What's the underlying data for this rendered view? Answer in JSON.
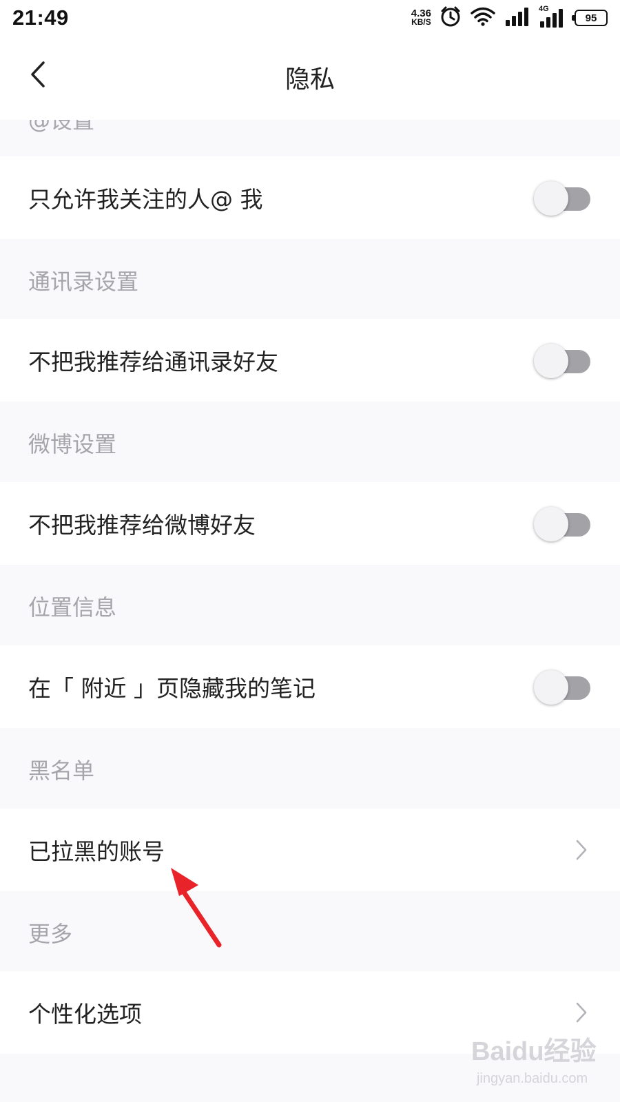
{
  "status_bar": {
    "time": "21:49",
    "net_speed_value": "4.36",
    "net_speed_unit": "KB/S",
    "signal_label": "4G",
    "battery": "95"
  },
  "header": {
    "title": "隐私"
  },
  "cut_section": {
    "label": "@设置"
  },
  "rows": {
    "at_only_followed": {
      "label": "只允许我关注的人@ 我",
      "enabled": false
    },
    "contacts_section": "通讯录设置",
    "no_recommend_contacts": {
      "label": "不把我推荐给通讯录好友",
      "enabled": false
    },
    "weibo_section": "微博设置",
    "no_recommend_weibo": {
      "label": "不把我推荐给微博好友",
      "enabled": false
    },
    "location_section": "位置信息",
    "hide_nearby": {
      "label": "在「 附近 」页隐藏我的笔记",
      "enabled": false
    },
    "blacklist_section": "黑名单",
    "blocked_accounts": {
      "label": "已拉黑的账号"
    },
    "more_section": "更多",
    "personalization": {
      "label": "个性化选项"
    }
  },
  "watermark": {
    "main": "Baidu经验",
    "sub": "jingyan.baidu.com"
  },
  "colors": {
    "annotation_arrow": "#e8232a",
    "toggle_track_off": "#a3a2a7",
    "section_text": "#a6a5ab"
  }
}
